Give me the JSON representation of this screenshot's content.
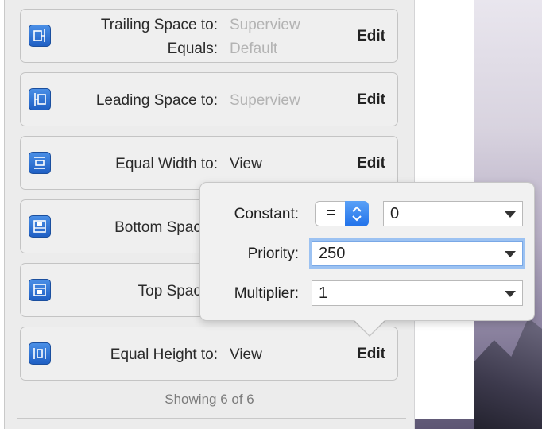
{
  "constraints": [
    {
      "icon": "trailing-space-icon",
      "label": "Trailing Space to:",
      "value": "Superview",
      "value_placeholder": true,
      "label2": "Equals:",
      "value2": "Default",
      "edit": "Edit"
    },
    {
      "icon": "leading-space-icon",
      "label": "Leading Space to:",
      "value": "Superview",
      "value_placeholder": true,
      "edit": "Edit"
    },
    {
      "icon": "equal-width-icon",
      "label": "Equal Width to:",
      "value": "View",
      "edit": "Edit"
    },
    {
      "icon": "bottom-space-icon",
      "label": "Bottom Space t",
      "value": "",
      "edit": ""
    },
    {
      "icon": "top-space-icon",
      "label": "Top Space t",
      "value": "",
      "edit": ""
    },
    {
      "icon": "equal-height-icon",
      "label": "Equal Height to:",
      "value": "View",
      "edit": "Edit"
    }
  ],
  "footer": {
    "showing": "Showing 6 of 6"
  },
  "popover": {
    "constant_label": "Constant:",
    "relation": "=",
    "constant_value": "0",
    "priority_label": "Priority:",
    "priority_value": "250",
    "multiplier_label": "Multiplier:",
    "multiplier_value": "1"
  },
  "colors": {
    "accent": "#2172ea",
    "focus_ring": "#9cc2f2",
    "icon_blue": "#1f5fc4"
  }
}
